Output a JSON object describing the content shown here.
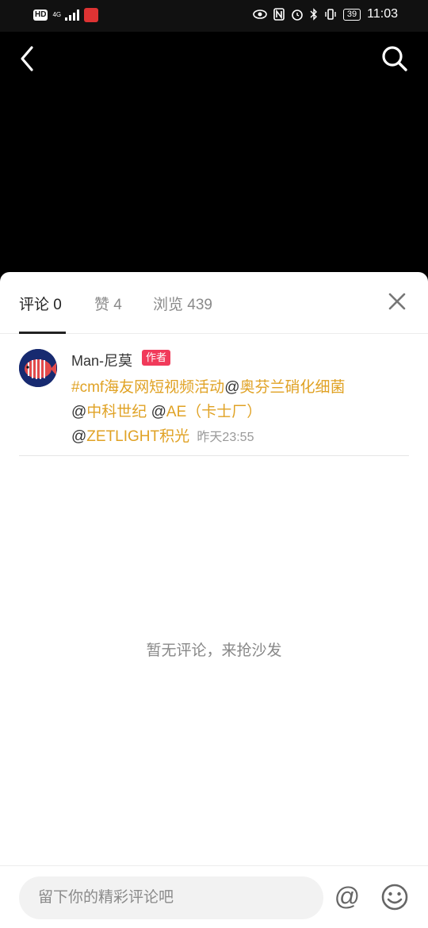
{
  "status_bar": {
    "hd": "HD",
    "network": "4G",
    "battery": "39",
    "time": "11:03"
  },
  "tabs": [
    {
      "label": "评论 0",
      "active": true
    },
    {
      "label": "赞 4",
      "active": false
    },
    {
      "label": "浏览 439",
      "active": false
    }
  ],
  "post": {
    "author": "Man-尼莫",
    "badge": "作者",
    "hashtag": "#cmf海友网短视频活动",
    "mention_1": "奥芬兰硝化细菌",
    "mention_2": "中科世纪",
    "mention_3": "AE（卡士厂）",
    "mention_4": "ZETLIGHT积光",
    "at_symbol": "@",
    "time": "昨天23:55"
  },
  "empty_message": "暂无评论，来抢沙发",
  "comment_bar": {
    "placeholder": "留下你的精彩评论吧",
    "at_label": "@"
  },
  "colors": {
    "highlight": "#e0a224",
    "badge": "#f13a5a"
  }
}
